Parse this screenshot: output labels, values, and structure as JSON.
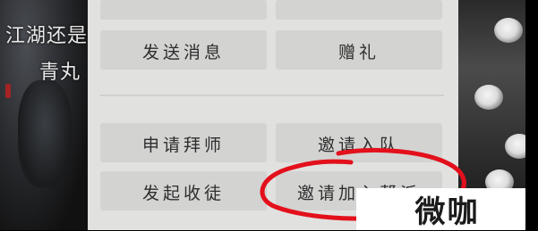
{
  "background_text": {
    "line1": "江湖还是",
    "line2": "青丸"
  },
  "menu": {
    "send_message": "发送消息",
    "gift": "赠礼",
    "apply_master": "申请拜师",
    "invite_team": "邀请入队",
    "take_disciple": "发起收徒",
    "invite_join": "邀请加入帮派"
  },
  "watermark": {
    "text": "微咖"
  },
  "annotation": {
    "color": "#e3101b"
  }
}
